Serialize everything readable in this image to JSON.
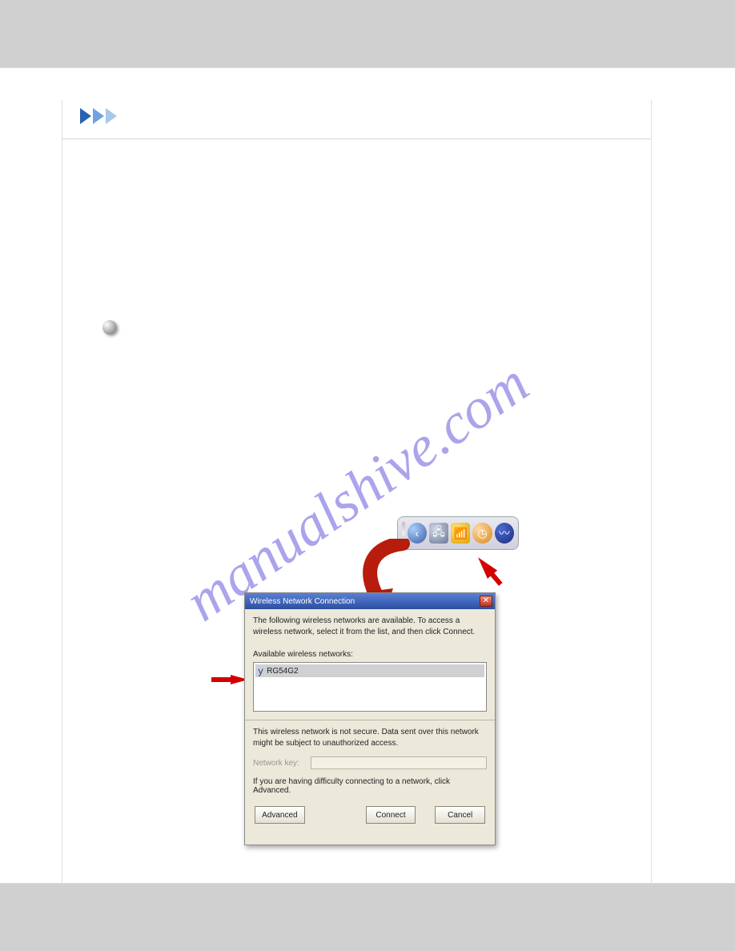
{
  "watermark": "manualshive.com",
  "systray": {
    "icons": [
      "back-icon",
      "network-icon",
      "wifi-icon",
      "clock-icon",
      "wave-icon"
    ]
  },
  "dialog": {
    "title": "Wireless Network Connection",
    "intro": "The following wireless networks are available. To access a wireless network, select it from the list, and then click Connect.",
    "list_label": "Available wireless networks:",
    "network_item": "RG54G2",
    "not_secure_note": "This wireless network is not secure. Data sent over this network might be subject to unauthorized access.",
    "key_label": "Network key:",
    "trouble_text": "If you are having difficulty connecting to a network, click Advanced.",
    "buttons": {
      "advanced": "Advanced",
      "connect": "Connect",
      "cancel": "Cancel"
    }
  }
}
